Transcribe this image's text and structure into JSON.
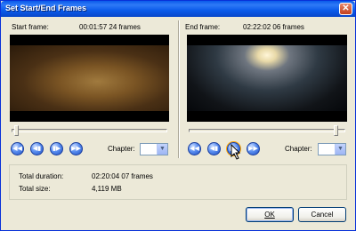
{
  "window": {
    "title": "Set Start/End Frames",
    "close_glyph": "✕"
  },
  "start": {
    "label": "Start frame:",
    "timecode": "00:01:57 24 frames",
    "chapter_label": "Chapter:",
    "chapter_value": ""
  },
  "end": {
    "label": "End frame:",
    "timecode": "02:22:02 06 frames",
    "chapter_label": "Chapter:",
    "chapter_value": ""
  },
  "controls": {
    "icons": [
      "rewind-icon",
      "step-back-icon",
      "step-forward-icon",
      "fast-forward-icon"
    ],
    "glyphs": [
      "◀◀",
      "◀▮",
      "▮▶",
      "▶▶"
    ]
  },
  "summary": {
    "duration_label": "Total duration:",
    "duration_value": "02:20:04 07 frames",
    "size_label": "Total size:",
    "size_value": "4,119 MB"
  },
  "buttons": {
    "ok_label": "OK",
    "cancel_label": "Cancel"
  },
  "colors": {
    "titlebar": "#0a5bea",
    "dialog_bg": "#ece9d8",
    "control_blue": "#3d6fdc"
  }
}
